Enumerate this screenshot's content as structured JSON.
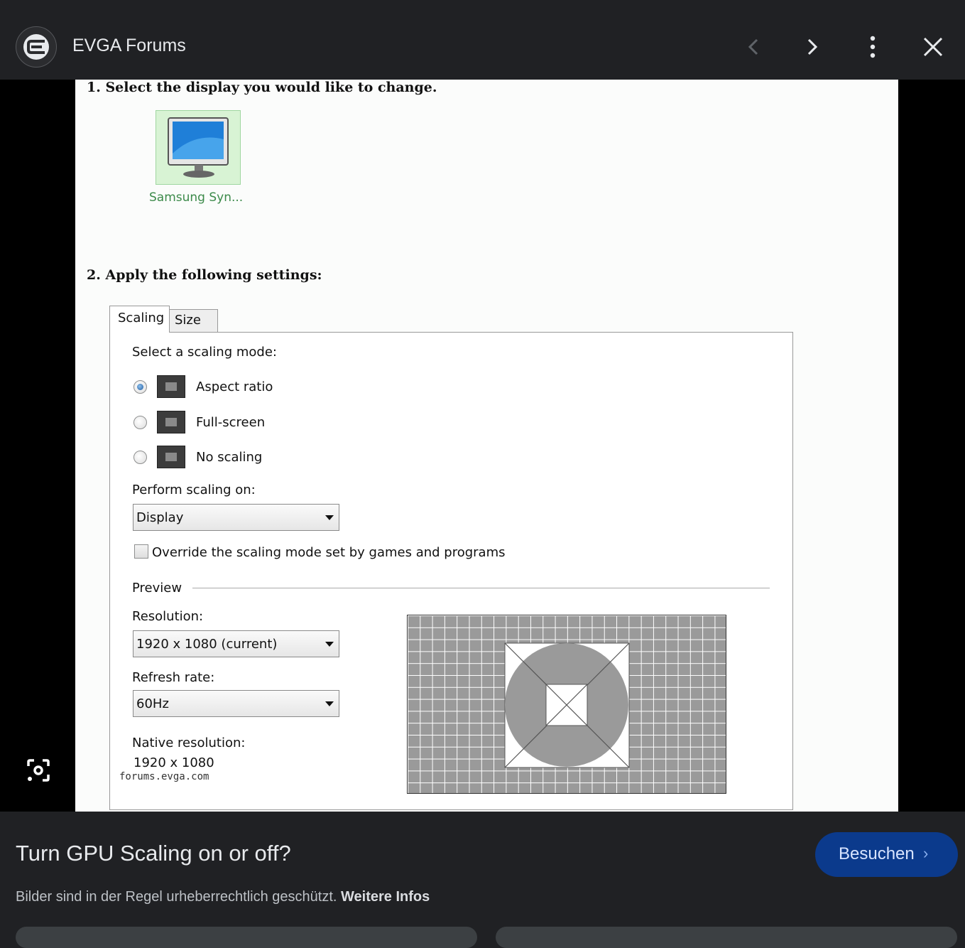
{
  "header": {
    "site_name": "EVGA Forums",
    "logo_icon": "evga-logo-icon",
    "prev_icon": "chevron-left-icon",
    "next_icon": "chevron-right-icon",
    "menu_icon": "more-vert-icon",
    "close_icon": "close-icon"
  },
  "screenshot": {
    "step1": "1. Select the display you would like to change.",
    "display_label": "Samsung Syn...",
    "step2": "2. Apply the following settings:",
    "tabs": [
      "Scaling",
      "Size"
    ],
    "scaling_mode_label": "Select a scaling mode:",
    "modes": [
      {
        "label": "Aspect ratio",
        "selected": true
      },
      {
        "label": "Full-screen",
        "selected": false
      },
      {
        "label": "No scaling",
        "selected": false
      }
    ],
    "perform_label": "Perform scaling on:",
    "perform_value": "Display",
    "override_label": "Override the scaling mode set by games and programs",
    "preview_label": "Preview",
    "resolution_label": "Resolution:",
    "resolution_value": "1920 x 1080 (current)",
    "refresh_label": "Refresh rate:",
    "refresh_value": "60Hz",
    "native_label": "Native resolution:",
    "native_value": "1920 x 1080",
    "watermark": "forums.evga.com"
  },
  "footer": {
    "title": "Turn GPU Scaling on or off?",
    "visit_label": "Besuchen",
    "copyright_text": "Bilder sind in der Regel urheberrechtlich geschützt.",
    "more_info": "Weitere Infos"
  },
  "colors": {
    "background": "#202124",
    "button": "#0b3a8c",
    "selection_green": "#d8f3d4"
  }
}
